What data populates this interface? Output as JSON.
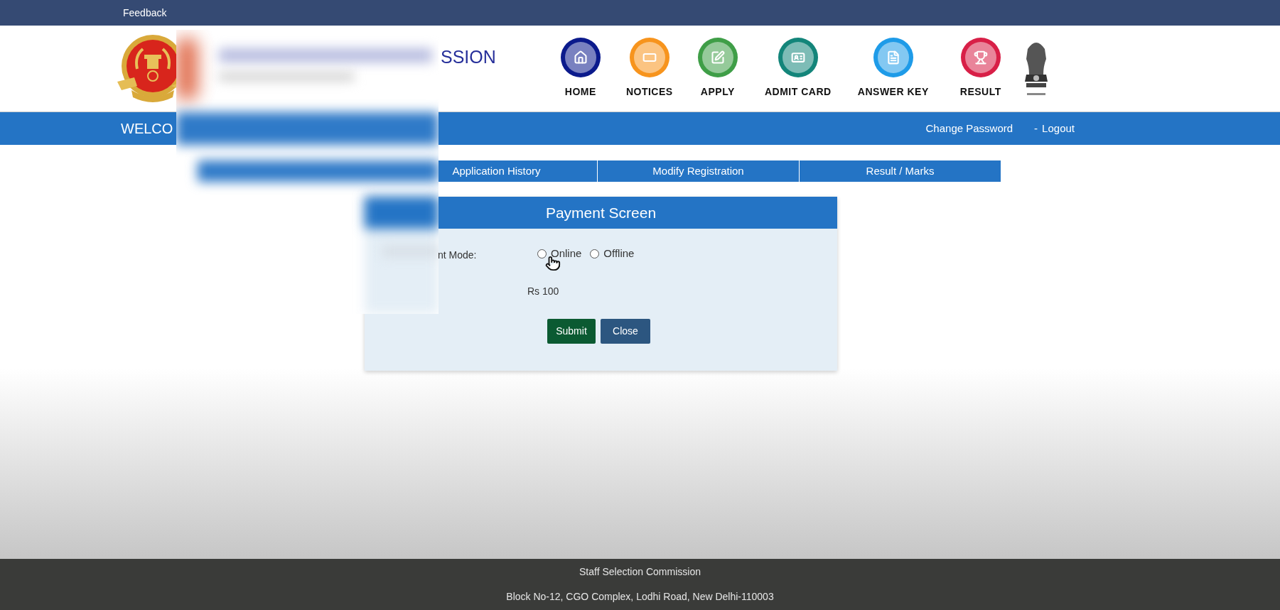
{
  "top_bar": {
    "link": "Feedback"
  },
  "header": {
    "title_fragment": "SSION",
    "nav": [
      {
        "label": "HOME",
        "color": "#0b1a8c"
      },
      {
        "label": "NOTICES",
        "color": "#f7941d"
      },
      {
        "label": "APPLY",
        "color": "#3f9e47"
      },
      {
        "label": "ADMIT CARD",
        "color": "#13857a"
      },
      {
        "label": "ANSWER KEY",
        "color": "#1e9be8"
      },
      {
        "label": "RESULT",
        "color": "#d81f47"
      }
    ]
  },
  "welcome_bar": {
    "welcome_fragment": "WELCO",
    "links": [
      "Change Password",
      "Logout"
    ],
    "separator": "-"
  },
  "tabs": [
    "Application History",
    "Modify Registration",
    "Result / Marks"
  ],
  "dialog": {
    "title": "Payment Screen",
    "mode_label_fragment": "nt Mode:",
    "options": [
      {
        "label": "Online",
        "selected": false
      },
      {
        "label": "Offline",
        "selected": false
      }
    ],
    "amount": "Rs 100",
    "buttons": [
      {
        "label": "Submit",
        "kind": "primary"
      },
      {
        "label": "Close",
        "kind": "secondary"
      }
    ]
  },
  "footer": {
    "lines": [
      "Staff Selection Commission",
      "Block No-12, CGO Complex, Lodhi Road, New Delhi-110003"
    ]
  }
}
